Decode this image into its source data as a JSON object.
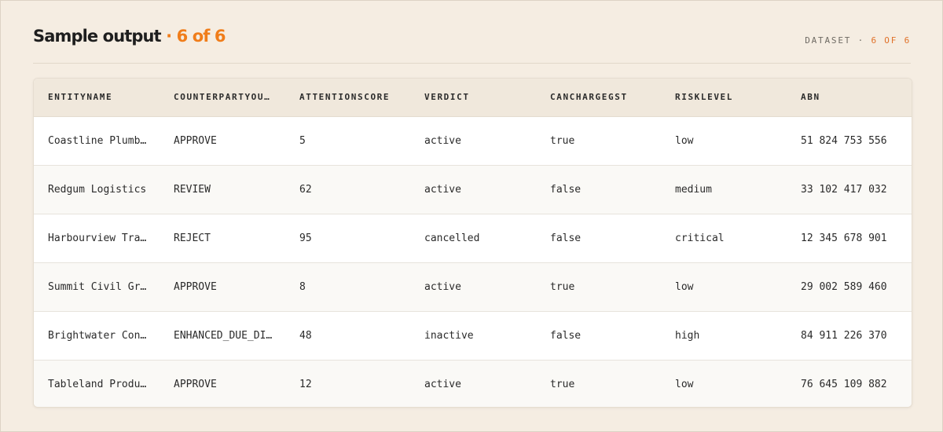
{
  "header": {
    "title": "Sample output",
    "separator": "·",
    "count": "6 of 6",
    "dataset_label": "DATASET ·",
    "dataset_count": "6 OF 6"
  },
  "table": {
    "columns": [
      "ENTITYNAME",
      "COUNTERPARTYOUTCOME",
      "ATTENTIONSCORE",
      "VERDICT",
      "CANCHARGEGST",
      "RISKLEVEL",
      "ABN"
    ],
    "rows": [
      [
        "Coastline Plumbing",
        "APPROVE",
        "5",
        "active",
        "true",
        "low",
        "51 824 753 556"
      ],
      [
        "Redgum Logistics",
        "REVIEW",
        "62",
        "active",
        "false",
        "medium",
        "33 102 417 032"
      ],
      [
        "Harbourview Traders",
        "REJECT",
        "95",
        "cancelled",
        "false",
        "critical",
        "12 345 678 901"
      ],
      [
        "Summit Civil Group",
        "APPROVE",
        "8",
        "active",
        "true",
        "low",
        "29 002 589 460"
      ],
      [
        "Brightwater Consulting",
        "ENHANCED_DUE_DILIGENCE",
        "48",
        "inactive",
        "false",
        "high",
        "84 911 226 370"
      ],
      [
        "Tableland Produce",
        "APPROVE",
        "12",
        "active",
        "true",
        "low",
        "76 645 109 882"
      ]
    ]
  },
  "colors": {
    "background": "#f5ede2",
    "accent": "#f07d1a",
    "header_row": "#f0e8dc"
  }
}
